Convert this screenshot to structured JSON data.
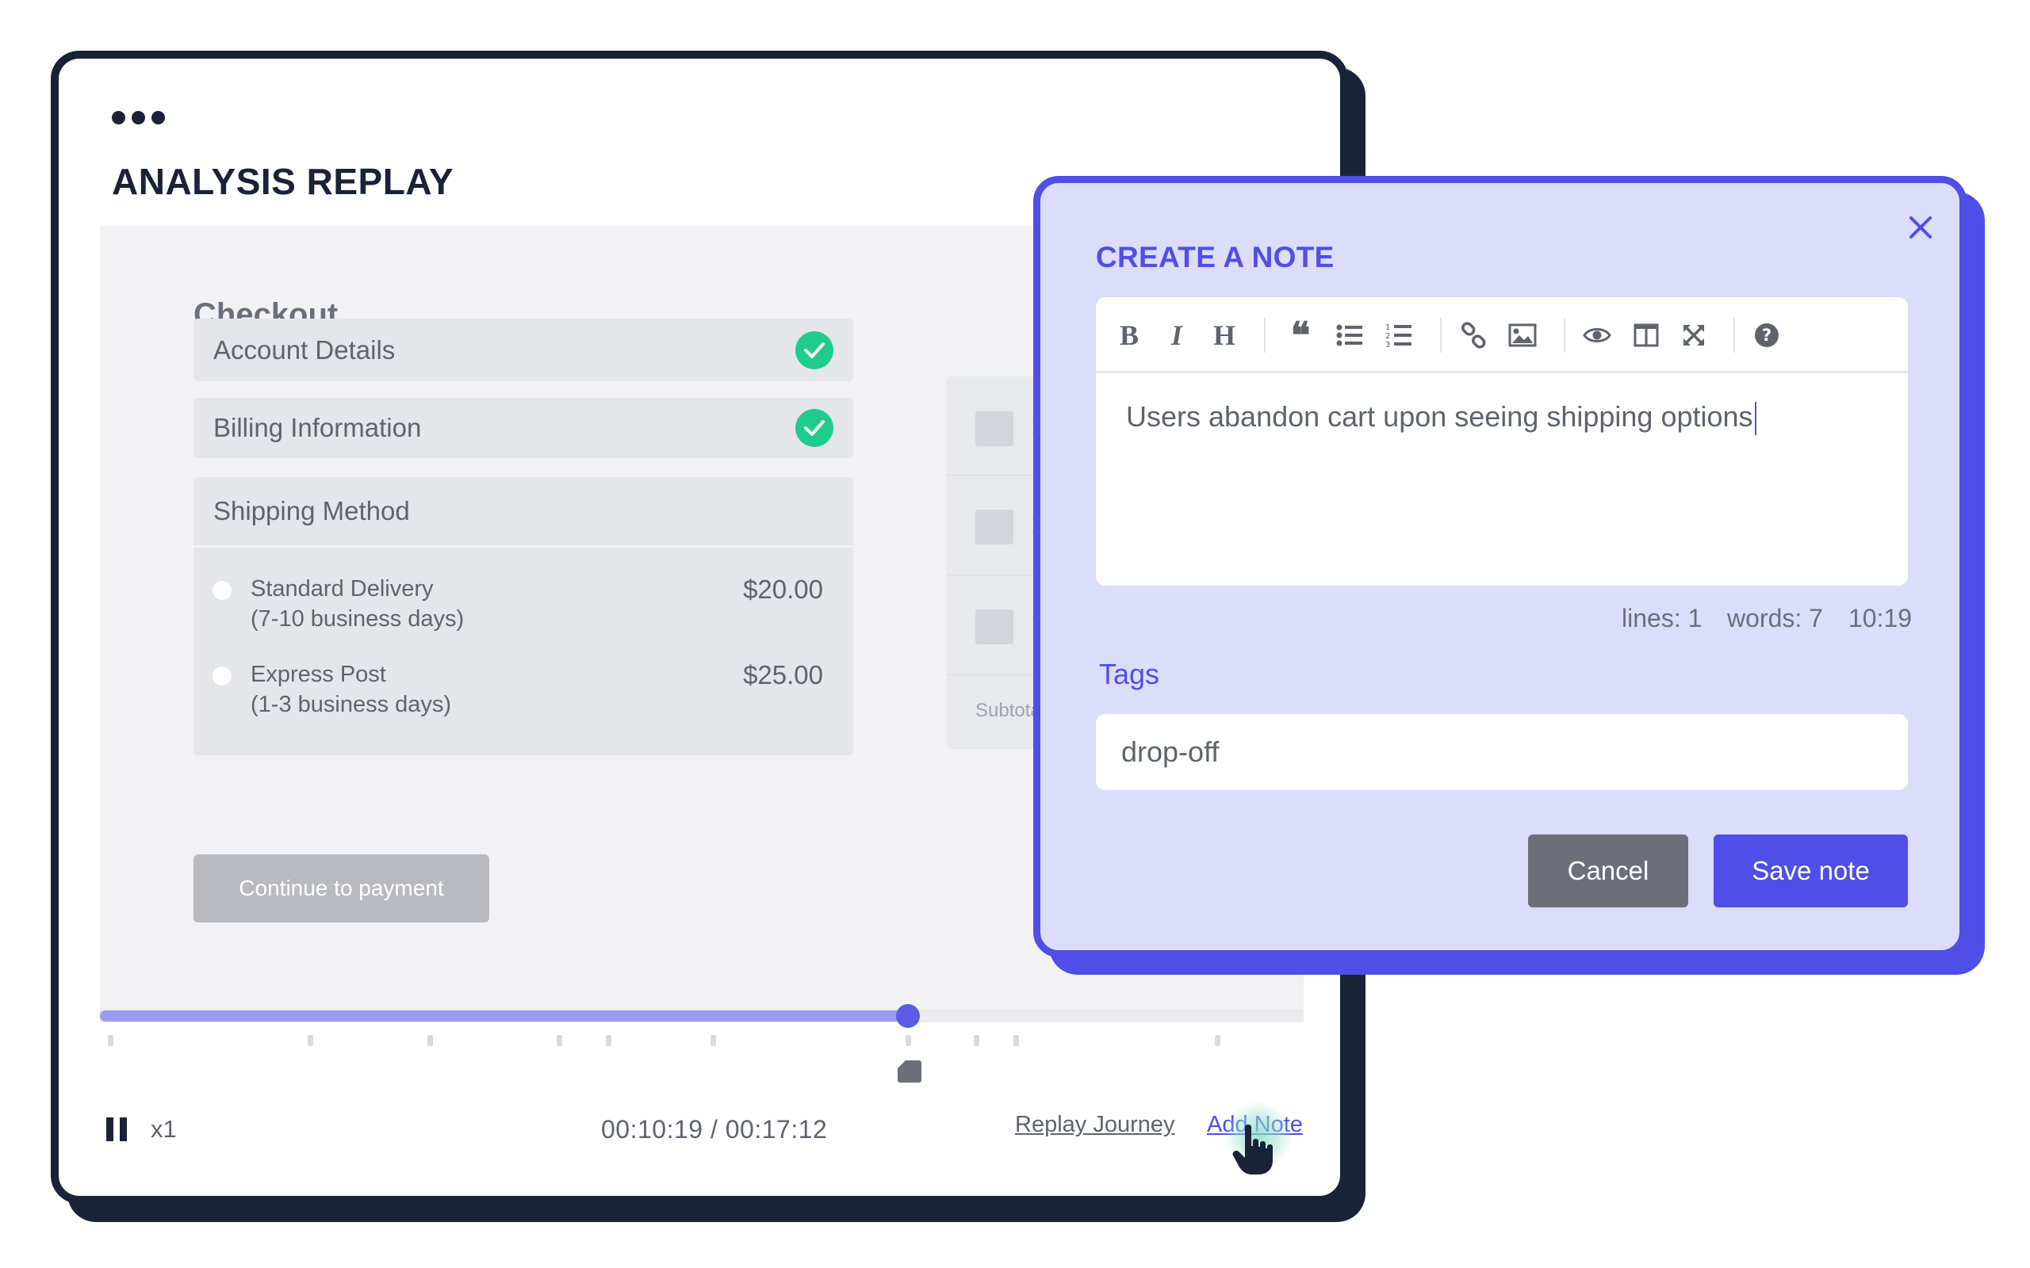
{
  "window": {
    "title": "ANALYSIS REPLAY"
  },
  "checkout": {
    "heading": "Checkout",
    "steps": [
      {
        "label": "Account Details",
        "complete": true
      },
      {
        "label": "Billing Information",
        "complete": true
      },
      {
        "label": "Shipping Method",
        "complete": false
      }
    ],
    "shipping_options": [
      {
        "name": "Standard Delivery",
        "detail": "(7-10 business days)",
        "price": "$20.00"
      },
      {
        "name": "Express Post",
        "detail": "(1-3 business days)",
        "price": "$25.00"
      }
    ],
    "continue_label": "Continue to payment",
    "summary": {
      "subtotal_label": "Subtotal"
    }
  },
  "player": {
    "speed": "x1",
    "timecode": "00:10:19 / 00:17:12",
    "progress": 0.6,
    "replay_journey_label": "Replay Journey",
    "add_note_label": "Add Note"
  },
  "note_modal": {
    "title": "CREATE A NOTE",
    "toolbar": [
      "bold-icon",
      "italic-icon",
      "heading-icon",
      "quote-icon",
      "bullet-list-icon",
      "numbered-list-icon",
      "link-icon",
      "image-icon",
      "preview-icon",
      "side-by-side-icon",
      "fullscreen-icon",
      "help-icon"
    ],
    "body_text": "Users abandon cart upon seeing shipping options",
    "status": {
      "lines": "lines: 1",
      "words": "words: 7",
      "cursor": "10:19"
    },
    "tags_label": "Tags",
    "tags_value": "drop-off",
    "cancel_label": "Cancel",
    "save_label": "Save note"
  },
  "colors": {
    "navy": "#1a2238",
    "accent": "#4f4fe8",
    "modal_bg": "#dcdcfb",
    "success": "#20cc8d",
    "timeline_fill": "#9a9af2"
  }
}
